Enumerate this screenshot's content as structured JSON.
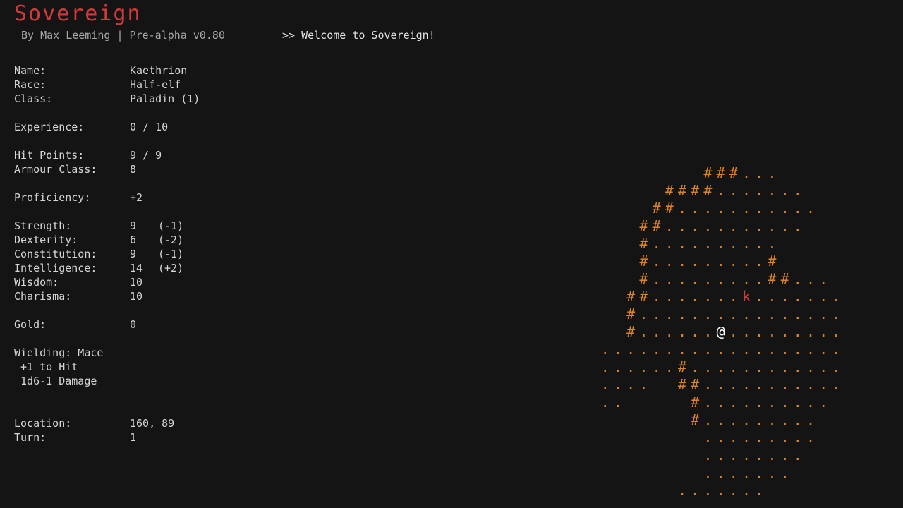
{
  "header": {
    "title": "Sovereign",
    "byline": "By Max Leeming | Pre-alpha v0.80",
    "message": ">> Welcome to Sovereign!"
  },
  "character": {
    "name_label": "Name:",
    "name": "Kaethrion",
    "race_label": "Race:",
    "race": "Half-elf",
    "class_label": "Class:",
    "class": "Paladin (1)",
    "experience_label": "Experience:",
    "experience": "0 / 10",
    "hp_label": "Hit Points:",
    "hp": "9 / 9",
    "ac_label": "Armour Class:",
    "ac": "8",
    "proficiency_label": "Proficiency:",
    "proficiency": "+2",
    "strength_label": "Strength:",
    "strength": "9",
    "strength_mod": "(-1)",
    "dexterity_label": "Dexterity:",
    "dexterity": "6",
    "dexterity_mod": "(-2)",
    "constitution_label": "Constitution:",
    "constitution": "9",
    "constitution_mod": "(-1)",
    "intelligence_label": "Intelligence:",
    "intelligence": "14",
    "intelligence_mod": "(+2)",
    "wisdom_label": "Wisdom:",
    "wisdom": "10",
    "charisma_label": "Charisma:",
    "charisma": "10",
    "gold_label": "Gold:",
    "gold": "0",
    "wielding": "Wielding: Mace",
    "to_hit": " +1 to Hit",
    "damage": " 1d6-1 Damage",
    "location_label": "Location:",
    "location": "160, 89",
    "turn_label": "Turn:",
    "turn": "1"
  },
  "map": {
    "col0": 0,
    "rows": [
      "            ###...     ",
      "         ####.......   ",
      "        ##...........  ",
      "       ##...........   ",
      "       #..........     ",
      "       #.........#     ",
      "       #.........##... ",
      "      ##.......k....... ",
      "      #................ ",
      "      #......@......... ",
      "    ................... ",
      "    ......#............ ",
      "    ....  ##........... ",
      "    ..     #.......... ",
      "           #.........  ",
      "            .........   ",
      "            ........   ",
      "            .......    ",
      "          .......     "
    ],
    "legend": {
      "wall": "#",
      "floor": ".",
      "monster": "k",
      "player": "@"
    },
    "colors": {
      "wall": "#d9822b",
      "floor": "#d9822b",
      "monster": "#d23a3a",
      "player": "#ffffff",
      "background": "#141414",
      "title": "#d23a3a"
    }
  }
}
